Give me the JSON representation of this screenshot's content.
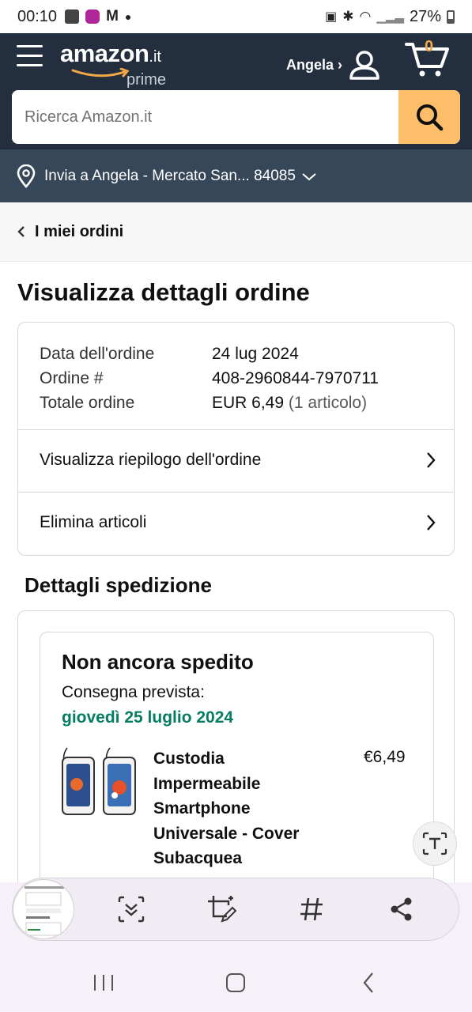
{
  "status_bar": {
    "time": "00:10",
    "battery": "27%"
  },
  "header": {
    "logo_word": "amazon",
    "logo_tld": ".it",
    "logo_prime": "prime",
    "account_label": "Angela ›",
    "cart_count": "0"
  },
  "search": {
    "placeholder": "Ricerca Amazon.it"
  },
  "delivery": {
    "label": "Invia a Angela - Mercato San... 84085"
  },
  "nav": {
    "back_label": "I miei ordini"
  },
  "page": {
    "title": "Visualizza dettagli ordine"
  },
  "order": {
    "date_label": "Data dell'ordine",
    "date_value": "24 lug 2024",
    "number_label": "Ordine #",
    "number_value": "408-2960844-7970711",
    "total_label": "Totale ordine",
    "total_value": "EUR 6,49",
    "total_items": "(1 articolo)",
    "summary_link": "Visualizza riepilogo dell'ordine",
    "delete_link": "Elimina articoli"
  },
  "shipment": {
    "section_title": "Dettagli spedizione",
    "status": "Non ancora spedito",
    "expected_label": "Consegna prevista:",
    "expected_date": "giovedì 25 luglio 2024",
    "product_name": "Custodia Impermeabile Smartphone Universale - Cover Subacquea",
    "product_price": "€6,49"
  },
  "colors": {
    "header_bg": "#232f3e",
    "delivery_bg": "#37475a",
    "search_button": "#febd69",
    "delivery_date": "#067d62",
    "cart_count": "#f3a847"
  },
  "icons": {
    "toolbar": [
      "screenshot-preview",
      "scroll-capture-icon",
      "crop-edit-icon",
      "hashtag-icon",
      "share-icon"
    ],
    "navbar": [
      "recents-icon",
      "home-icon",
      "back-icon"
    ]
  }
}
